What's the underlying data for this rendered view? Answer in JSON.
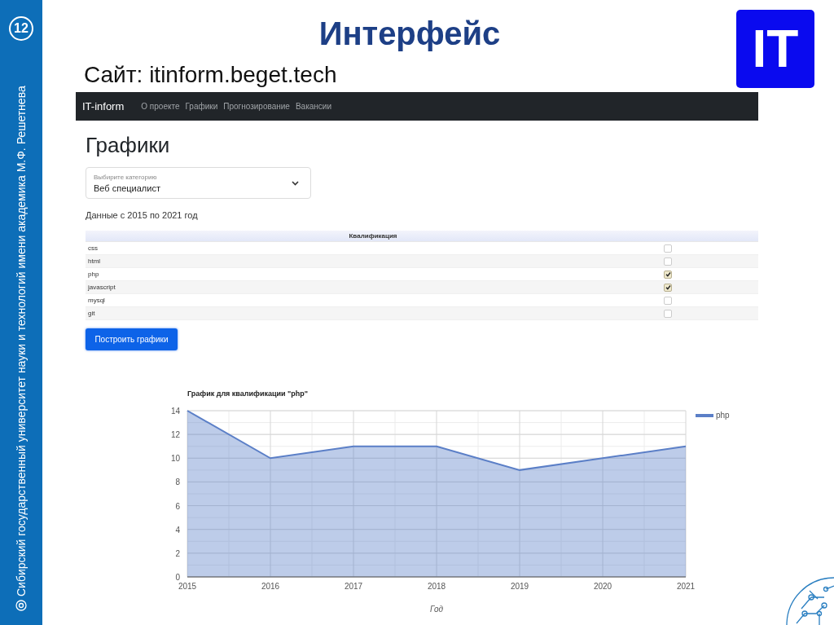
{
  "slide": {
    "page_number": "12",
    "side_text": "Сибирский государственный университет науки и технологий имени академика М.Ф. Решетнева",
    "title": "Интерфейс",
    "subtitle": "Сайт: itinform.beget.tech",
    "logo_text": "IT"
  },
  "site": {
    "brand": "IT-inform",
    "nav": [
      {
        "label": "О проекте"
      },
      {
        "label": "Графики"
      },
      {
        "label": "Прогнозирование"
      },
      {
        "label": "Вакансии"
      }
    ],
    "heading": "Графики",
    "select": {
      "label": "Выбирите категорию",
      "value": "Веб специалист"
    },
    "data_range": "Данные с 2015 по 2021 год",
    "table": {
      "header": "Квалификация",
      "rows": [
        {
          "label": "css",
          "checked": false
        },
        {
          "label": "html",
          "checked": false
        },
        {
          "label": "php",
          "checked": true
        },
        {
          "label": "javascript",
          "checked": true
        },
        {
          "label": "mysql",
          "checked": false
        },
        {
          "label": "git",
          "checked": false
        }
      ]
    },
    "button": "Построить графики",
    "chart": {
      "chart_data": {
        "type": "area",
        "title": "График для квалификации \"php\"",
        "xlabel": "Год",
        "categories": [
          "2015",
          "2016",
          "2017",
          "2018",
          "2019",
          "2020",
          "2021"
        ],
        "series": [
          {
            "name": "php",
            "color": "#5b7fc7",
            "values": [
              14,
              10,
              11,
              11,
              9,
              10,
              11
            ]
          }
        ],
        "grid": true,
        "ylim": [
          0,
          14
        ],
        "yticks": [
          0,
          2,
          4,
          6,
          8,
          10,
          12,
          14
        ]
      }
    }
  }
}
